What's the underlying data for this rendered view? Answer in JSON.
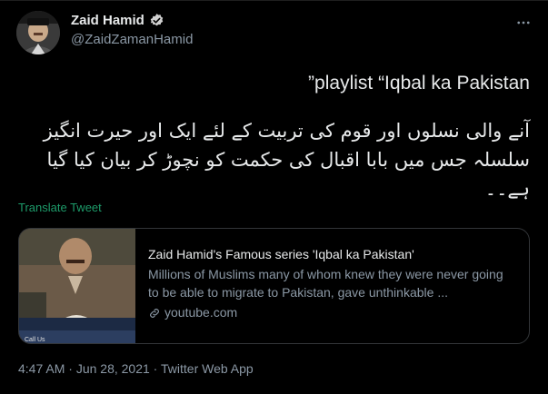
{
  "author": {
    "display_name": "Zaid Hamid",
    "handle": "@ZaidZamanHamid",
    "verified_icon": "verified-badge-icon",
    "avatar_icon": "avatar"
  },
  "more_icon": "more-dots-icon",
  "tweet": {
    "line1": "”playlist “Iqbal ka Pakistan",
    "urdu_text": "آنے والی نسلوں اور قوم کی تربیت کے لئے ایک اور حیرت انگیز سلسلہ جس میں بابا اقبال کی حکمت کو نچوڑ کر بیان کیا گیا ہے۔۔",
    "translate_label": "Translate Tweet"
  },
  "card": {
    "title": "Zaid Hamid's Famous series 'Iqbal ka Pakistan'",
    "description": "Millions of Muslims many of whom knew they were never going to be able to migrate to Pakistan, gave unthinkable ...",
    "domain": "youtube.com",
    "link_icon": "link-icon",
    "thumbnail_caption": "Call Us"
  },
  "meta": {
    "time": "4:47 AM",
    "sep1": " · ",
    "date": "Jun 28, 2021",
    "sep2": " · ",
    "source": "Twitter Web App"
  },
  "colors": {
    "background": "#000000",
    "text": "#e7e9ea",
    "secondary": "#8b98a5",
    "translate_link": "#1d9b6a",
    "verified": "#8b98a5"
  }
}
